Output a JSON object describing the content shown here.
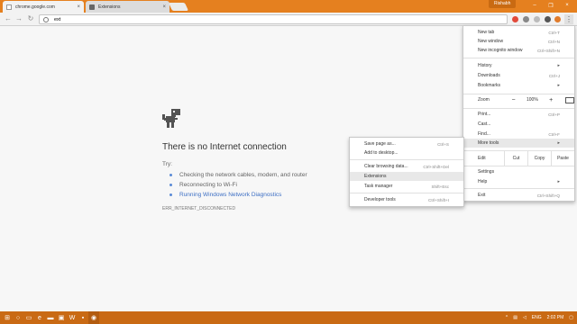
{
  "tabs": [
    {
      "title": "chrome.google.com",
      "active": true
    },
    {
      "title": "Extensions",
      "active": false
    }
  ],
  "profile_name": "Rishabh",
  "omnibox_value": "ext",
  "error": {
    "title": "There is no Internet connection",
    "try_label": "Try:",
    "suggestions": [
      {
        "text": "Checking the network cables, modem, and router"
      },
      {
        "text": "Reconnecting to Wi-Fi"
      },
      {
        "text": "Running Windows Network Diagnostics"
      }
    ],
    "code": "ERR_INTERNET_DISCONNECTED"
  },
  "main_menu": {
    "new_tab": {
      "label": "New tab",
      "shortcut": "Ctrl+T"
    },
    "new_window": {
      "label": "New window",
      "shortcut": "Ctrl+N"
    },
    "new_incognito": {
      "label": "New incognito window",
      "shortcut": "Ctrl+Shift+N"
    },
    "history": {
      "label": "History",
      "arrow": "▸"
    },
    "downloads": {
      "label": "Downloads",
      "shortcut": "Ctrl+J"
    },
    "bookmarks": {
      "label": "Bookmarks",
      "arrow": "▸"
    },
    "zoom": {
      "label": "Zoom",
      "minus": "−",
      "value": "100%",
      "plus": "+"
    },
    "print": {
      "label": "Print...",
      "shortcut": "Ctrl+P"
    },
    "cast": {
      "label": "Cast..."
    },
    "find": {
      "label": "Find...",
      "shortcut": "Ctrl+F"
    },
    "more_tools": {
      "label": "More tools",
      "arrow": "▸"
    },
    "edit": {
      "label": "Edit",
      "cut": "Cut",
      "copy": "Copy",
      "paste": "Paste"
    },
    "settings": {
      "label": "Settings"
    },
    "help": {
      "label": "Help",
      "arrow": "▸"
    },
    "exit": {
      "label": "Exit",
      "shortcut": "Ctrl+Shift+Q"
    }
  },
  "sub_menu": {
    "save_page": {
      "label": "Save page as...",
      "shortcut": "Ctrl+S"
    },
    "add_desktop": {
      "label": "Add to desktop..."
    },
    "clear_browsing": {
      "label": "Clear browsing data...",
      "shortcut": "Ctrl+Shift+Del"
    },
    "extensions": {
      "label": "Extensions"
    },
    "task_manager": {
      "label": "Task manager",
      "shortcut": "Shift+Esc"
    },
    "dev_tools": {
      "label": "Developer tools",
      "shortcut": "Ctrl+Shift+I"
    }
  },
  "tray": {
    "lang": "ENG",
    "time": "2:02 PM"
  },
  "colors": {
    "accent": "#e5801f",
    "taskbar": "#c96a14",
    "link": "#3d6fc4"
  }
}
